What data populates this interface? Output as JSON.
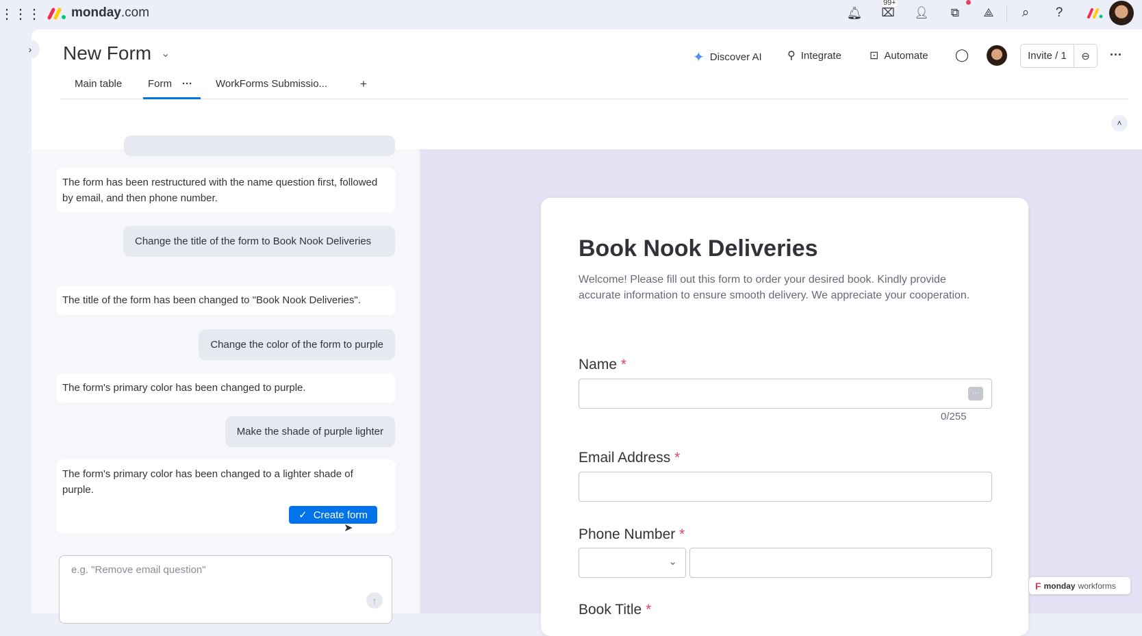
{
  "topbar": {
    "brand": "monday",
    "brand_suffix": ".com",
    "inbox_badge": "99+"
  },
  "header": {
    "title": "New Form",
    "discover_ai": "Discover AI",
    "integrate": "Integrate",
    "automate": "Automate",
    "invite": "Invite / 1"
  },
  "tabs": [
    {
      "label": "Main table"
    },
    {
      "label": "Form",
      "active": true
    },
    {
      "label": "WorkForms Submissio..."
    }
  ],
  "tab_add": "+",
  "chat": {
    "messages": [
      {
        "role": "ai",
        "text": "The form has been restructured with the name question first, followed by email, and then phone number."
      },
      {
        "role": "user",
        "text": "Change the title of the form to Book Nook Deliveries"
      },
      {
        "role": "ai",
        "text": "The title of the form has been changed to \"Book Nook Deliveries\"."
      },
      {
        "role": "user",
        "text": "Change the color of the form to purple"
      },
      {
        "role": "ai",
        "text": "The form's primary color has been changed to purple."
      },
      {
        "role": "user",
        "text": "Make the shade of purple lighter"
      },
      {
        "role": "ai",
        "text": "The form's primary color has been changed to a lighter shade of purple."
      }
    ],
    "create_button": "Create form",
    "input_placeholder": "e.g. \"Remove email question\""
  },
  "form": {
    "title": "Book Nook Deliveries",
    "description": "Welcome! Please fill out this form to order your desired book. Kindly provide accurate information to ensure smooth delivery. We appreciate your cooperation.",
    "fields": [
      {
        "label": "Name",
        "counter": "0/255"
      },
      {
        "label": "Email Address"
      },
      {
        "label": "Phone Number"
      },
      {
        "label": "Book Title"
      }
    ],
    "required_mark": "*"
  },
  "badge": {
    "bold": "monday",
    "rest": "workforms"
  },
  "colors": {
    "accent": "#0073ea",
    "required": "#e2445c",
    "form_bg": "#e3e3f5"
  }
}
